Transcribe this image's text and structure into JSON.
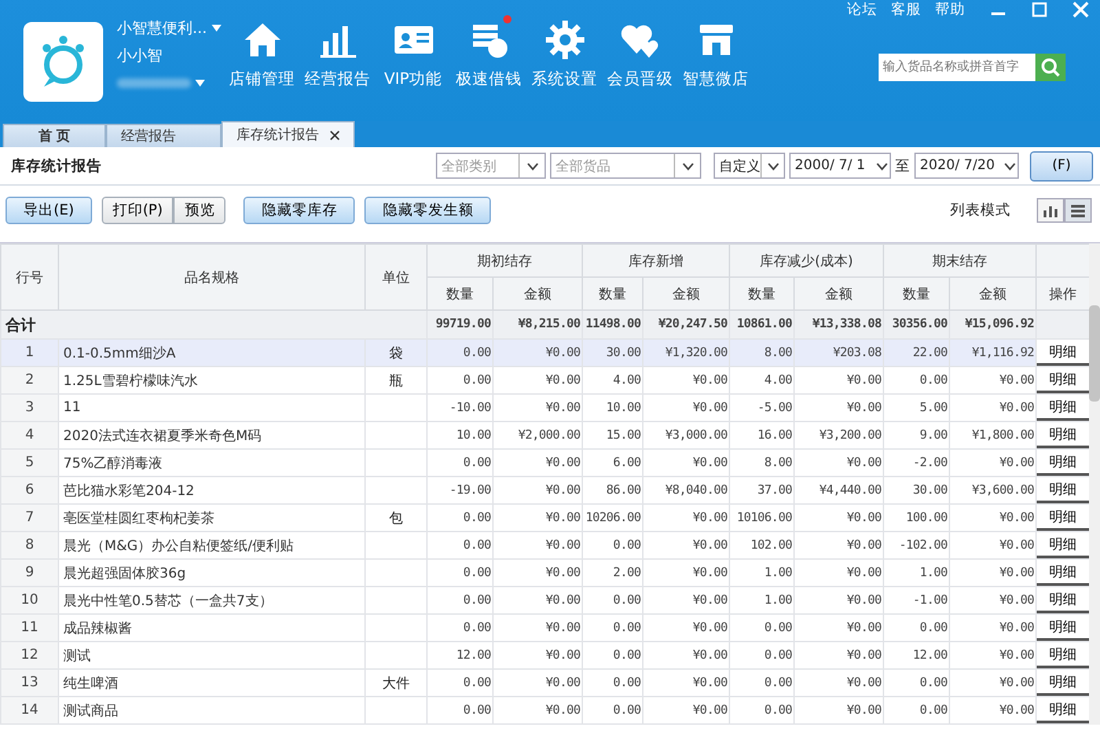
{
  "account": {
    "store": "小智慧便利...",
    "user": "小小智"
  },
  "top_links": [
    "论坛",
    "客服",
    "帮助"
  ],
  "nav": [
    {
      "label": "店铺管理"
    },
    {
      "label": "经营报告"
    },
    {
      "label": "VIP功能"
    },
    {
      "label": "极速借钱",
      "badge": true
    },
    {
      "label": "系统设置"
    },
    {
      "label": "会员晋级"
    },
    {
      "label": "智慧微店"
    }
  ],
  "search": {
    "placeholder": "输入货品名称或拼音首字"
  },
  "tabs": [
    {
      "label": "首 页",
      "selected": false,
      "closable": false
    },
    {
      "label": "经营报告",
      "selected": false,
      "closable": false
    },
    {
      "label": "库存统计报告",
      "selected": true,
      "closable": true
    }
  ],
  "report_title": "库存统计报告",
  "filters": {
    "category": "全部类别",
    "product": "全部货品",
    "period": "自定义",
    "date_from": "2000/ 7/ 1",
    "to": "至",
    "date_to": "2020/ 7/20",
    "query_button": "(F)"
  },
  "buttons": [
    {
      "label": "导出(E)",
      "highlighted": true
    },
    {
      "label": "打印(P)",
      "highlighted": false
    },
    {
      "label": "预览",
      "highlighted": false
    },
    {
      "label": "隐藏零库存",
      "highlighted": true
    },
    {
      "label": "隐藏零发生额",
      "highlighted": true
    }
  ],
  "view_mode": {
    "label": "列表模式",
    "options": [
      {
        "kind": "chart",
        "selected": false
      },
      {
        "kind": "list",
        "selected": true
      }
    ]
  },
  "table": {
    "columns": [
      "行号",
      "品名规格",
      "单位"
    ],
    "groups": [
      {
        "label": "期初结存",
        "sub_columns": [
          "数量",
          "金额"
        ]
      },
      {
        "label": "库存新增",
        "sub_columns": [
          "数量",
          "金额"
        ]
      },
      {
        "label": "库存减少(成本)",
        "sub_columns": [
          "数量",
          "金额"
        ]
      },
      {
        "label": "期末结存",
        "sub_columns": [
          "数量",
          "金额"
        ]
      }
    ],
    "action_column": "操作",
    "total": {
      "label": "合计",
      "values": [
        "99719.00",
        "¥8,215.00",
        "11498.00",
        "¥20,247.50",
        "10861.00",
        "¥13,338.08",
        "30356.00",
        "¥15,096.92"
      ]
    },
    "rows": [
      {
        "no": "1",
        "name": "0.1-0.5mm细沙A",
        "unit": "袋",
        "values": [
          "0.00",
          "¥0.00",
          "30.00",
          "¥1,320.00",
          "8.00",
          "¥203.08",
          "22.00",
          "¥1,116.92"
        ],
        "action": "明细",
        "selected": true
      },
      {
        "no": "2",
        "name": "1.25L雪碧柠檬味汽水",
        "unit": "瓶",
        "values": [
          "0.00",
          "¥0.00",
          "4.00",
          "¥0.00",
          "4.00",
          "¥0.00",
          "0.00",
          "¥0.00"
        ],
        "action": "明细",
        "selected": false
      },
      {
        "no": "3",
        "name": "11",
        "unit": "",
        "values": [
          "-10.00",
          "¥0.00",
          "10.00",
          "¥0.00",
          "-5.00",
          "¥0.00",
          "5.00",
          "¥0.00"
        ],
        "action": "明细",
        "selected": false
      },
      {
        "no": "4",
        "name": "2020法式连衣裙夏季米奇色M码",
        "unit": "",
        "values": [
          "10.00",
          "¥2,000.00",
          "15.00",
          "¥3,000.00",
          "16.00",
          "¥3,200.00",
          "9.00",
          "¥1,800.00"
        ],
        "action": "明细",
        "selected": false
      },
      {
        "no": "5",
        "name": "75%乙醇消毒液",
        "unit": "",
        "values": [
          "0.00",
          "¥0.00",
          "6.00",
          "¥0.00",
          "8.00",
          "¥0.00",
          "-2.00",
          "¥0.00"
        ],
        "action": "明细",
        "selected": false
      },
      {
        "no": "6",
        "name": "芭比猫水彩笔204-12",
        "unit": "",
        "values": [
          "-19.00",
          "¥0.00",
          "86.00",
          "¥8,040.00",
          "37.00",
          "¥4,440.00",
          "30.00",
          "¥3,600.00"
        ],
        "action": "明细",
        "selected": false
      },
      {
        "no": "7",
        "name": "亳医堂桂圆红枣枸杞姜茶",
        "unit": "包",
        "values": [
          "0.00",
          "¥0.00",
          "10206.00",
          "¥0.00",
          "10106.00",
          "¥0.00",
          "100.00",
          "¥0.00"
        ],
        "action": "明细",
        "selected": false
      },
      {
        "no": "8",
        "name": "晨光（M&G）办公自粘便签纸/便利贴",
        "unit": "",
        "values": [
          "0.00",
          "¥0.00",
          "0.00",
          "¥0.00",
          "102.00",
          "¥0.00",
          "-102.00",
          "¥0.00"
        ],
        "action": "明细",
        "selected": false
      },
      {
        "no": "9",
        "name": "晨光超强固体胶36g",
        "unit": "",
        "values": [
          "0.00",
          "¥0.00",
          "2.00",
          "¥0.00",
          "1.00",
          "¥0.00",
          "1.00",
          "¥0.00"
        ],
        "action": "明细",
        "selected": false
      },
      {
        "no": "10",
        "name": "晨光中性笔0.5替芯（一盒共7支）",
        "unit": "",
        "values": [
          "0.00",
          "¥0.00",
          "0.00",
          "¥0.00",
          "1.00",
          "¥0.00",
          "-1.00",
          "¥0.00"
        ],
        "action": "明细",
        "selected": false
      },
      {
        "no": "11",
        "name": "成品辣椒酱",
        "unit": "",
        "values": [
          "0.00",
          "¥0.00",
          "0.00",
          "¥0.00",
          "0.00",
          "¥0.00",
          "0.00",
          "¥0.00"
        ],
        "action": "明细",
        "selected": false
      },
      {
        "no": "12",
        "name": "测试",
        "unit": "",
        "values": [
          "12.00",
          "¥0.00",
          "0.00",
          "¥0.00",
          "0.00",
          "¥0.00",
          "12.00",
          "¥0.00"
        ],
        "action": "明细",
        "selected": false
      },
      {
        "no": "13",
        "name": "纯生啤酒",
        "unit": "大件",
        "values": [
          "0.00",
          "¥0.00",
          "0.00",
          "¥0.00",
          "0.00",
          "¥0.00",
          "0.00",
          "¥0.00"
        ],
        "action": "明细",
        "selected": false
      },
      {
        "no": "14",
        "name": "测试商品",
        "unit": "",
        "values": [
          "0.00",
          "¥0.00",
          "0.00",
          "¥0.00",
          "0.00",
          "¥0.00",
          "0.00",
          "¥0.00"
        ],
        "action": "明细",
        "selected": false
      }
    ]
  }
}
